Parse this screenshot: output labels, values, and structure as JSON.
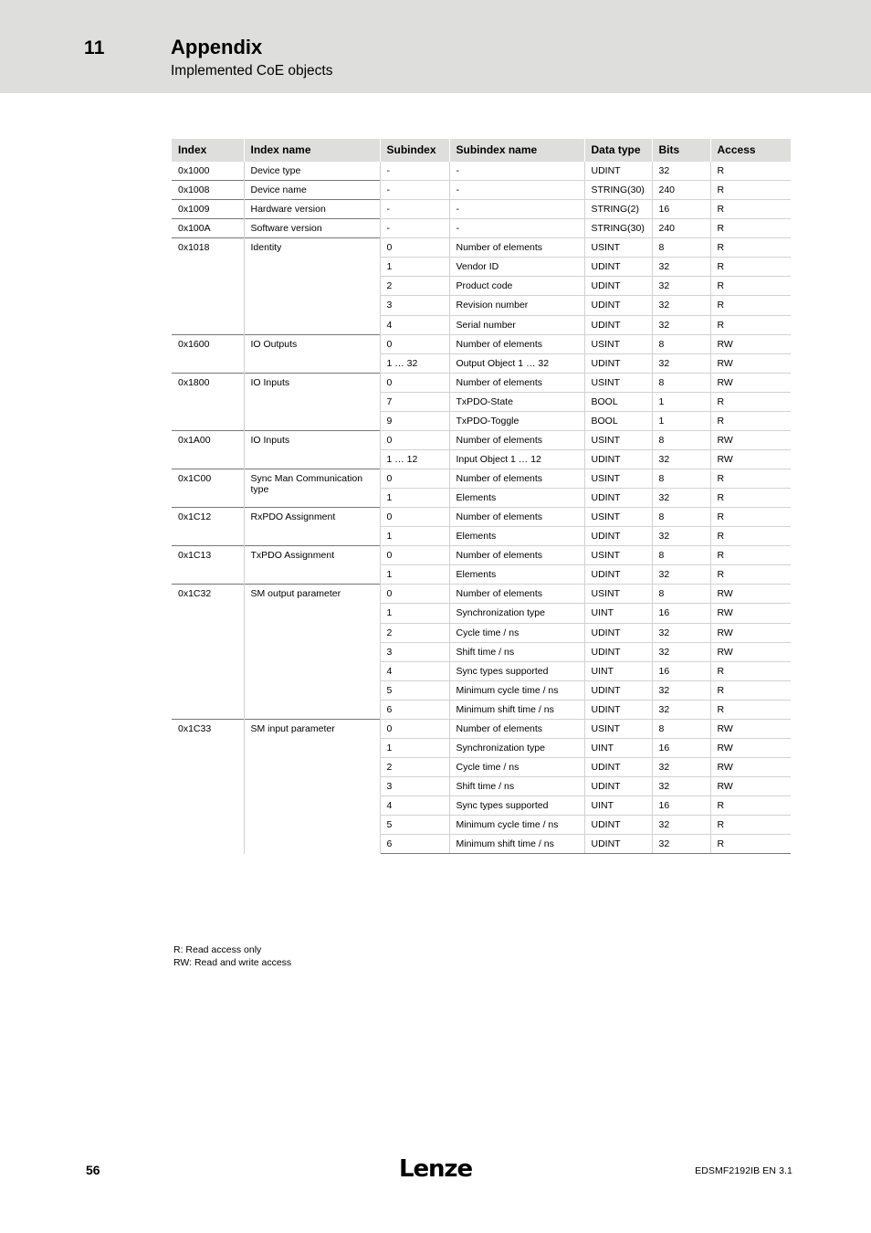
{
  "header": {
    "chapter_number": "11",
    "title": "Appendix",
    "subtitle": "Implemented CoE objects",
    "band_color": "#dededd"
  },
  "table": {
    "columns": [
      "Index",
      "Index name",
      "Subindex",
      "Subindex name",
      "Data type",
      "Bits",
      "Access"
    ],
    "rows": [
      {
        "index": "0x1000",
        "index_name": "Device type",
        "subindex": "-",
        "subindex_name": "-",
        "data_type": "UDINT",
        "bits": "32",
        "access": "R"
      },
      {
        "index": "0x1008",
        "index_name": "Device name",
        "subindex": "-",
        "subindex_name": "-",
        "data_type": "STRING(30)",
        "bits": "240",
        "access": "R"
      },
      {
        "index": "0x1009",
        "index_name": "Hardware version",
        "subindex": "-",
        "subindex_name": "-",
        "data_type": "STRING(2)",
        "bits": "16",
        "access": "R"
      },
      {
        "index": "0x100A",
        "index_name": "Software version",
        "subindex": "-",
        "subindex_name": "-",
        "data_type": "STRING(30)",
        "bits": "240",
        "access": "R"
      },
      {
        "index": "0x1018",
        "index_name": "Identity",
        "subindex": "0",
        "subindex_name": "Number of elements",
        "data_type": "USINT",
        "bits": "8",
        "access": "R"
      },
      {
        "index": "",
        "index_name": "",
        "subindex": "1",
        "subindex_name": "Vendor ID",
        "data_type": "UDINT",
        "bits": "32",
        "access": "R"
      },
      {
        "index": "",
        "index_name": "",
        "subindex": "2",
        "subindex_name": "Product code",
        "data_type": "UDINT",
        "bits": "32",
        "access": "R"
      },
      {
        "index": "",
        "index_name": "",
        "subindex": "3",
        "subindex_name": "Revision number",
        "data_type": "UDINT",
        "bits": "32",
        "access": "R"
      },
      {
        "index": "",
        "index_name": "",
        "subindex": "4",
        "subindex_name": "Serial number",
        "data_type": "UDINT",
        "bits": "32",
        "access": "R"
      },
      {
        "index": "0x1600",
        "index_name": "IO Outputs",
        "subindex": "0",
        "subindex_name": "Number of elements",
        "data_type": "USINT",
        "bits": "8",
        "access": "RW"
      },
      {
        "index": "",
        "index_name": "",
        "subindex": "1 … 32",
        "subindex_name": "Output Object 1 … 32",
        "data_type": "UDINT",
        "bits": "32",
        "access": "RW"
      },
      {
        "index": "0x1800",
        "index_name": "IO Inputs",
        "subindex": "0",
        "subindex_name": "Number of elements",
        "data_type": "USINT",
        "bits": "8",
        "access": "RW"
      },
      {
        "index": "",
        "index_name": "",
        "subindex": "7",
        "subindex_name": "TxPDO-State",
        "data_type": "BOOL",
        "bits": "1",
        "access": "R"
      },
      {
        "index": "",
        "index_name": "",
        "subindex": "9",
        "subindex_name": "TxPDO-Toggle",
        "data_type": "BOOL",
        "bits": "1",
        "access": "R"
      },
      {
        "index": "0x1A00",
        "index_name": "IO Inputs",
        "subindex": "0",
        "subindex_name": "Number of elements",
        "data_type": "USINT",
        "bits": "8",
        "access": "RW"
      },
      {
        "index": "",
        "index_name": "",
        "subindex": "1 … 12",
        "subindex_name": "Input Object 1 … 12",
        "data_type": "UDINT",
        "bits": "32",
        "access": "RW"
      },
      {
        "index": "0x1C00",
        "index_name": "Sync Man Communication type",
        "subindex": "0",
        "subindex_name": "Number of elements",
        "data_type": "USINT",
        "bits": "8",
        "access": "R"
      },
      {
        "index": "",
        "index_name": "",
        "subindex": "1",
        "subindex_name": "Elements",
        "data_type": "UDINT",
        "bits": "32",
        "access": "R"
      },
      {
        "index": "0x1C12",
        "index_name": "RxPDO Assignment",
        "subindex": "0",
        "subindex_name": "Number of elements",
        "data_type": "USINT",
        "bits": "8",
        "access": "R"
      },
      {
        "index": "",
        "index_name": "",
        "subindex": "1",
        "subindex_name": "Elements",
        "data_type": "UDINT",
        "bits": "32",
        "access": "R"
      },
      {
        "index": "0x1C13",
        "index_name": "TxPDO Assignment",
        "subindex": "0",
        "subindex_name": "Number of elements",
        "data_type": "USINT",
        "bits": "8",
        "access": "R"
      },
      {
        "index": "",
        "index_name": "",
        "subindex": "1",
        "subindex_name": "Elements",
        "data_type": "UDINT",
        "bits": "32",
        "access": "R"
      },
      {
        "index": "0x1C32",
        "index_name": "SM output parameter",
        "subindex": "0",
        "subindex_name": "Number of elements",
        "data_type": "USINT",
        "bits": "8",
        "access": "RW"
      },
      {
        "index": "",
        "index_name": "",
        "subindex": "1",
        "subindex_name": "Synchronization type",
        "data_type": "UINT",
        "bits": "16",
        "access": "RW"
      },
      {
        "index": "",
        "index_name": "",
        "subindex": "2",
        "subindex_name": "Cycle time / ns",
        "data_type": "UDINT",
        "bits": "32",
        "access": "RW"
      },
      {
        "index": "",
        "index_name": "",
        "subindex": "3",
        "subindex_name": "Shift time / ns",
        "data_type": "UDINT",
        "bits": "32",
        "access": "RW"
      },
      {
        "index": "",
        "index_name": "",
        "subindex": "4",
        "subindex_name": "Sync types supported",
        "data_type": "UINT",
        "bits": "16",
        "access": "R"
      },
      {
        "index": "",
        "index_name": "",
        "subindex": "5",
        "subindex_name": "Minimum cycle time / ns",
        "data_type": "UDINT",
        "bits": "32",
        "access": "R"
      },
      {
        "index": "",
        "index_name": "",
        "subindex": "6",
        "subindex_name": "Minimum shift time / ns",
        "data_type": "UDINT",
        "bits": "32",
        "access": "R"
      },
      {
        "index": "0x1C33",
        "index_name": "SM input parameter",
        "subindex": "0",
        "subindex_name": "Number of elements",
        "data_type": "USINT",
        "bits": "8",
        "access": "RW"
      },
      {
        "index": "",
        "index_name": "",
        "subindex": "1",
        "subindex_name": "Synchronization type",
        "data_type": "UINT",
        "bits": "16",
        "access": "RW"
      },
      {
        "index": "",
        "index_name": "",
        "subindex": "2",
        "subindex_name": "Cycle time / ns",
        "data_type": "UDINT",
        "bits": "32",
        "access": "RW"
      },
      {
        "index": "",
        "index_name": "",
        "subindex": "3",
        "subindex_name": "Shift time / ns",
        "data_type": "UDINT",
        "bits": "32",
        "access": "RW"
      },
      {
        "index": "",
        "index_name": "",
        "subindex": "4",
        "subindex_name": "Sync types supported",
        "data_type": "UINT",
        "bits": "16",
        "access": "R"
      },
      {
        "index": "",
        "index_name": "",
        "subindex": "5",
        "subindex_name": "Minimum cycle time / ns",
        "data_type": "UDINT",
        "bits": "32",
        "access": "R"
      },
      {
        "index": "",
        "index_name": "",
        "subindex": "6",
        "subindex_name": "Minimum shift time / ns",
        "data_type": "UDINT",
        "bits": "32",
        "access": "R"
      }
    ]
  },
  "footnotes": [
    "R: Read access only",
    "RW: Read and write access"
  ],
  "footer": {
    "page_number": "56",
    "brand": "Lenze",
    "document_id": "EDSMF2192IB EN 3.1"
  }
}
